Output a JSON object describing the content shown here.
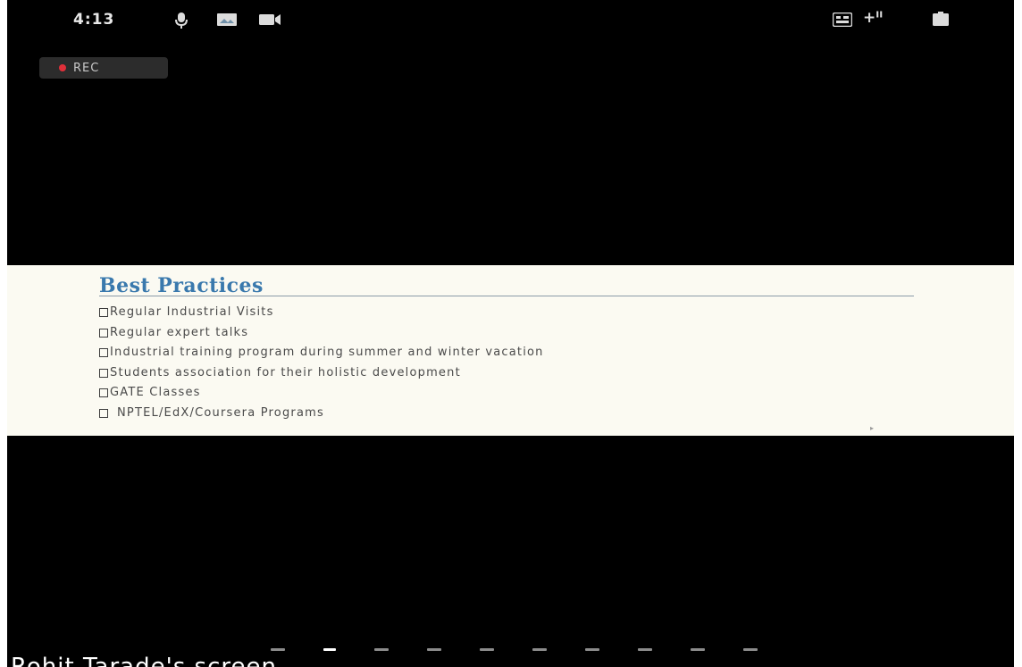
{
  "status_bar": {
    "time": "4:13",
    "signal": "+ᴵᴵ",
    "icons": [
      "microphone-icon",
      "gallery-icon",
      "video-camera-icon",
      "vowifi-icon",
      "signal-icon",
      "battery-icon"
    ]
  },
  "recording": {
    "label": "REC",
    "dot_color": "#e0303a"
  },
  "slide": {
    "title": "Best Practices",
    "title_color": "#3a79ad",
    "items": [
      "Regular Industrial Visits",
      "Regular expert talks",
      "Industrial training program during summer and winter vacation",
      "Students association for their holistic development",
      "GATE Classes",
      "NPTEL/EdX/Coursera Programs"
    ]
  },
  "pager": {
    "count": 10,
    "active_index": 1
  },
  "screen_share": {
    "owner_label": "Rohit Tarade's screen"
  }
}
